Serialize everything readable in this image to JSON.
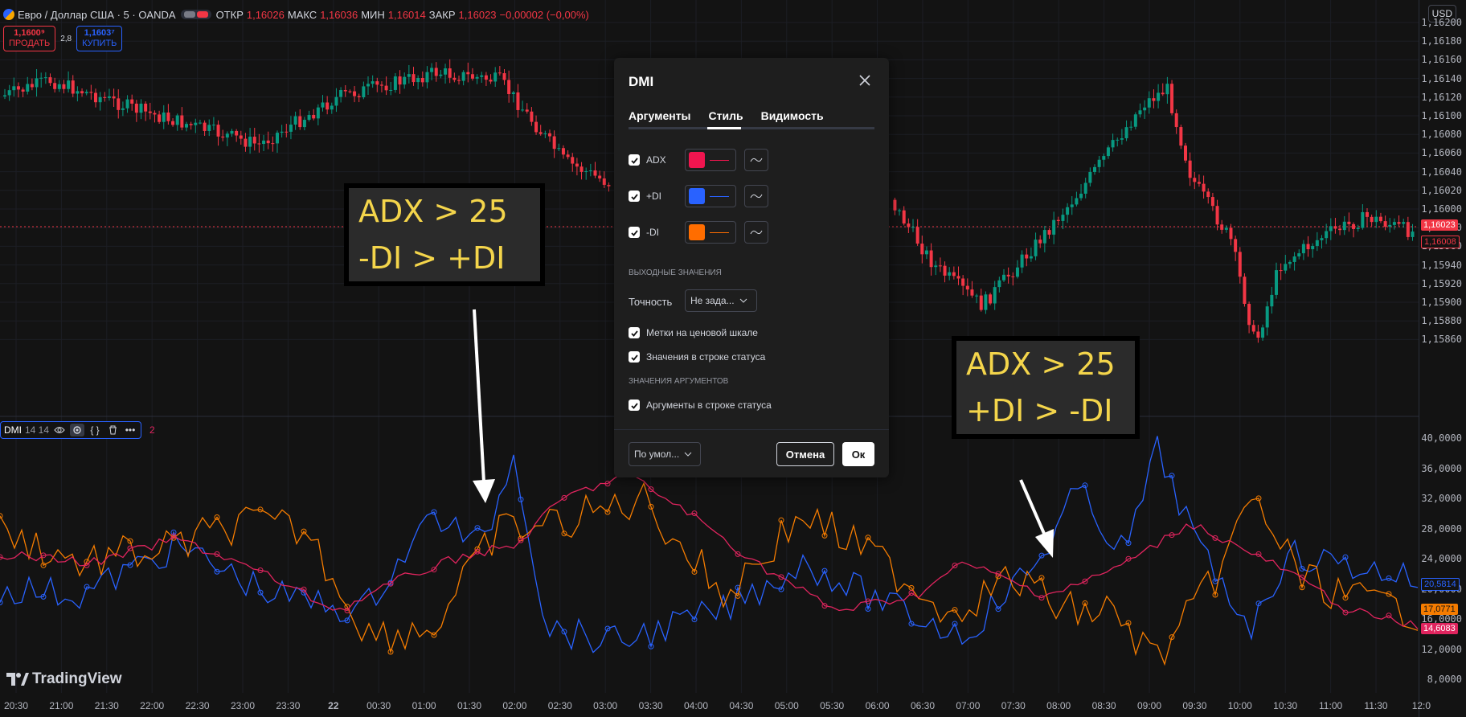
{
  "header": {
    "symbol": "Евро / Доллар США · 5 · OANDA",
    "open_label": "ОТКР",
    "open": "1,16026",
    "high_label": "МАКС",
    "high": "1,16036",
    "low_label": "МИН",
    "low": "1,16014",
    "close_label": "ЗАКР",
    "close": "1,16023",
    "change": "−0,00002 (−0,00%)",
    "currency": "USD"
  },
  "trade": {
    "sell_price": "1,1600⁹",
    "sell_label": "ПРОДАТЬ",
    "spread": "2,8",
    "buy_price": "1,1603⁷",
    "buy_label": "КУПИТЬ"
  },
  "price_axis": {
    "ticks": [
      "1,16200",
      "1,16180",
      "1,16160",
      "1,16140",
      "1,16120",
      "1,16100",
      "1,16080",
      "1,16060",
      "1,16040",
      "1,16020",
      "1,16000",
      "1,15980",
      "1,15960",
      "1,15940",
      "1,15920",
      "1,15900",
      "1,15880",
      "1,15860"
    ],
    "last_price": "1,16023",
    "bid_price": "1,16008"
  },
  "indicator_axis": {
    "ticks": [
      "40,0000",
      "36,0000",
      "32,0000",
      "28,0000",
      "24,0000",
      "20,0000",
      "16,0000",
      "12,0000",
      "8,0000"
    ],
    "plus_di_value": "20,5814",
    "minus_di_value": "17,0771",
    "adx_value": "14,6083"
  },
  "time_axis": {
    "ticks": [
      "20:30",
      "21:00",
      "21:30",
      "22:00",
      "22:30",
      "23:00",
      "23:30",
      "22",
      "00:30",
      "01:00",
      "01:30",
      "02:00",
      "02:30",
      "03:00",
      "03:30",
      "04:00",
      "04:30",
      "05:00",
      "05:30",
      "06:00",
      "06:30",
      "07:00",
      "07:30",
      "08:00",
      "08:30",
      "09:00",
      "09:30",
      "10:00",
      "10:30",
      "11:00",
      "11:30",
      "12:0"
    ]
  },
  "indicator_legend": {
    "name": "DMI",
    "params": "14 14",
    "trailing": "2"
  },
  "annotations": [
    {
      "line1": "ADX > 25",
      "line2": "-DI > +DI"
    },
    {
      "line1": "ADX > 25",
      "line2": "+DI > -DI"
    }
  ],
  "branding": {
    "logo": "TradingView"
  },
  "dialog": {
    "title": "DMI",
    "tabs": [
      "Аргументы",
      "Стиль",
      "Видимость"
    ],
    "active_tab": "Стиль",
    "plots": [
      {
        "label": "ADX",
        "color": "#f0154f"
      },
      {
        "label": "+DI",
        "color": "#2962ff"
      },
      {
        "label": "-DI",
        "color": "#ff6d00"
      }
    ],
    "output_section": "ВЫХОДНЫЕ ЗНАЧЕНИЯ",
    "precision_label": "Точность",
    "precision_value": "Не зада...",
    "scale_labels": "Метки на ценовой шкале",
    "status_values": "Значения в строке статуса",
    "args_section": "ЗНАЧЕНИЯ АРГУМЕНТОВ",
    "args_status": "Аргументы в строке статуса",
    "defaults": "По умол...",
    "cancel": "Отмена",
    "ok": "Ок"
  },
  "colors": {
    "up": "#089981",
    "down": "#f23645",
    "adx": "#e0245e",
    "plus_di": "#2962ff",
    "minus_di": "#f57c00"
  }
}
